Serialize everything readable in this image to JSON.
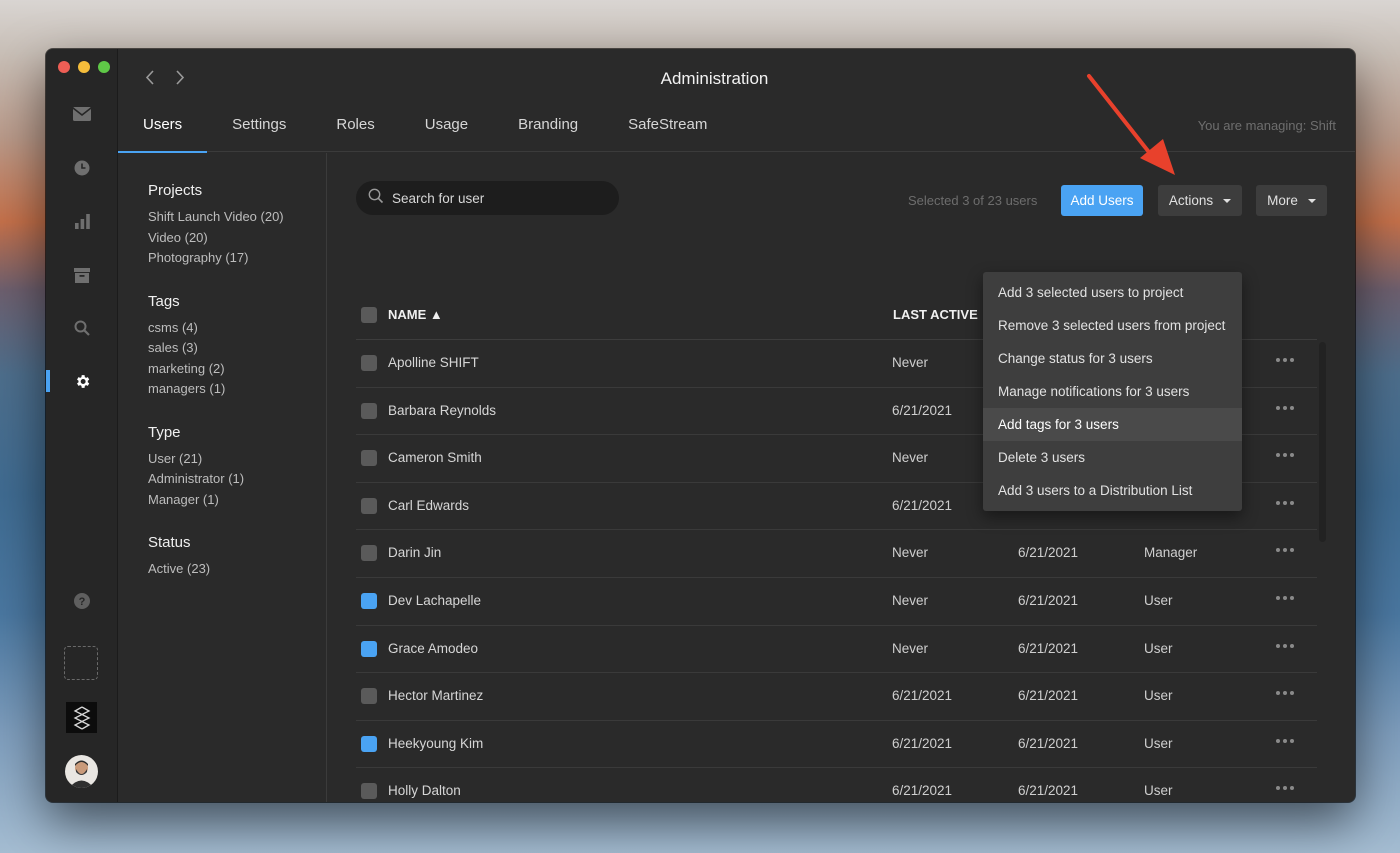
{
  "window": {
    "title": "Administration",
    "managing": "You are managing: Shift"
  },
  "tabs": [
    "Users",
    "Settings",
    "Roles",
    "Usage",
    "Branding",
    "SafeStream"
  ],
  "filters": {
    "projects": {
      "title": "Projects",
      "items": [
        "Shift Launch Video (20)",
        "Video (20)",
        "Photography (17)"
      ]
    },
    "tags": {
      "title": "Tags",
      "items": [
        "csms (4)",
        "sales (3)",
        "marketing (2)",
        "managers (1)"
      ]
    },
    "type": {
      "title": "Type",
      "items": [
        "User (21)",
        "Administrator (1)",
        "Manager (1)"
      ]
    },
    "status": {
      "title": "Status",
      "items": [
        "Active (23)"
      ]
    }
  },
  "search": {
    "placeholder": "Search for user"
  },
  "toolbar": {
    "selected": "Selected 3 of 23 users",
    "add_users": "Add Users",
    "actions": "Actions",
    "more": "More"
  },
  "table": {
    "headers": {
      "name": "NAME ▲",
      "last_active": "LAST ACTIVE"
    },
    "rows": [
      {
        "name": "Apolline SHIFT",
        "last": "Never",
        "created": "",
        "role": "",
        "checked": false
      },
      {
        "name": "Barbara Reynolds",
        "last": "6/21/2021",
        "created": "",
        "role": "",
        "checked": false
      },
      {
        "name": "Cameron Smith",
        "last": "Never",
        "created": "",
        "role": "",
        "checked": false
      },
      {
        "name": "Carl Edwards",
        "last": "6/21/2021",
        "created": "",
        "role": "",
        "checked": false
      },
      {
        "name": "Darin Jin",
        "last": "Never",
        "created": "6/21/2021",
        "role": "Manager",
        "checked": false
      },
      {
        "name": "Dev Lachapelle",
        "last": "Never",
        "created": "6/21/2021",
        "role": "User",
        "checked": true
      },
      {
        "name": "Grace Amodeo",
        "last": "Never",
        "created": "6/21/2021",
        "role": "User",
        "checked": true
      },
      {
        "name": "Hector Martinez",
        "last": "6/21/2021",
        "created": "6/21/2021",
        "role": "User",
        "checked": false
      },
      {
        "name": "Heekyoung Kim",
        "last": "6/21/2021",
        "created": "6/21/2021",
        "role": "User",
        "checked": true
      },
      {
        "name": "Holly Dalton",
        "last": "6/21/2021",
        "created": "6/21/2021",
        "role": "User",
        "checked": false
      }
    ]
  },
  "actions_menu": {
    "items": [
      "Add 3 selected users to project",
      "Remove 3 selected users from project",
      "Change status for 3 users",
      "Manage notifications for 3 users",
      "Add tags for 3 users",
      "Delete 3 users",
      "Add 3 users to a Distribution List"
    ],
    "highlighted": "Add tags for 3 users"
  },
  "colors": {
    "accent": "#4aa3f3",
    "annotation_arrow": "#e8412c"
  },
  "rail_icons": [
    "inbox-icon",
    "clock-icon",
    "bar-chart-icon",
    "archive-icon",
    "search-icon",
    "gear-icon",
    "help-icon"
  ]
}
